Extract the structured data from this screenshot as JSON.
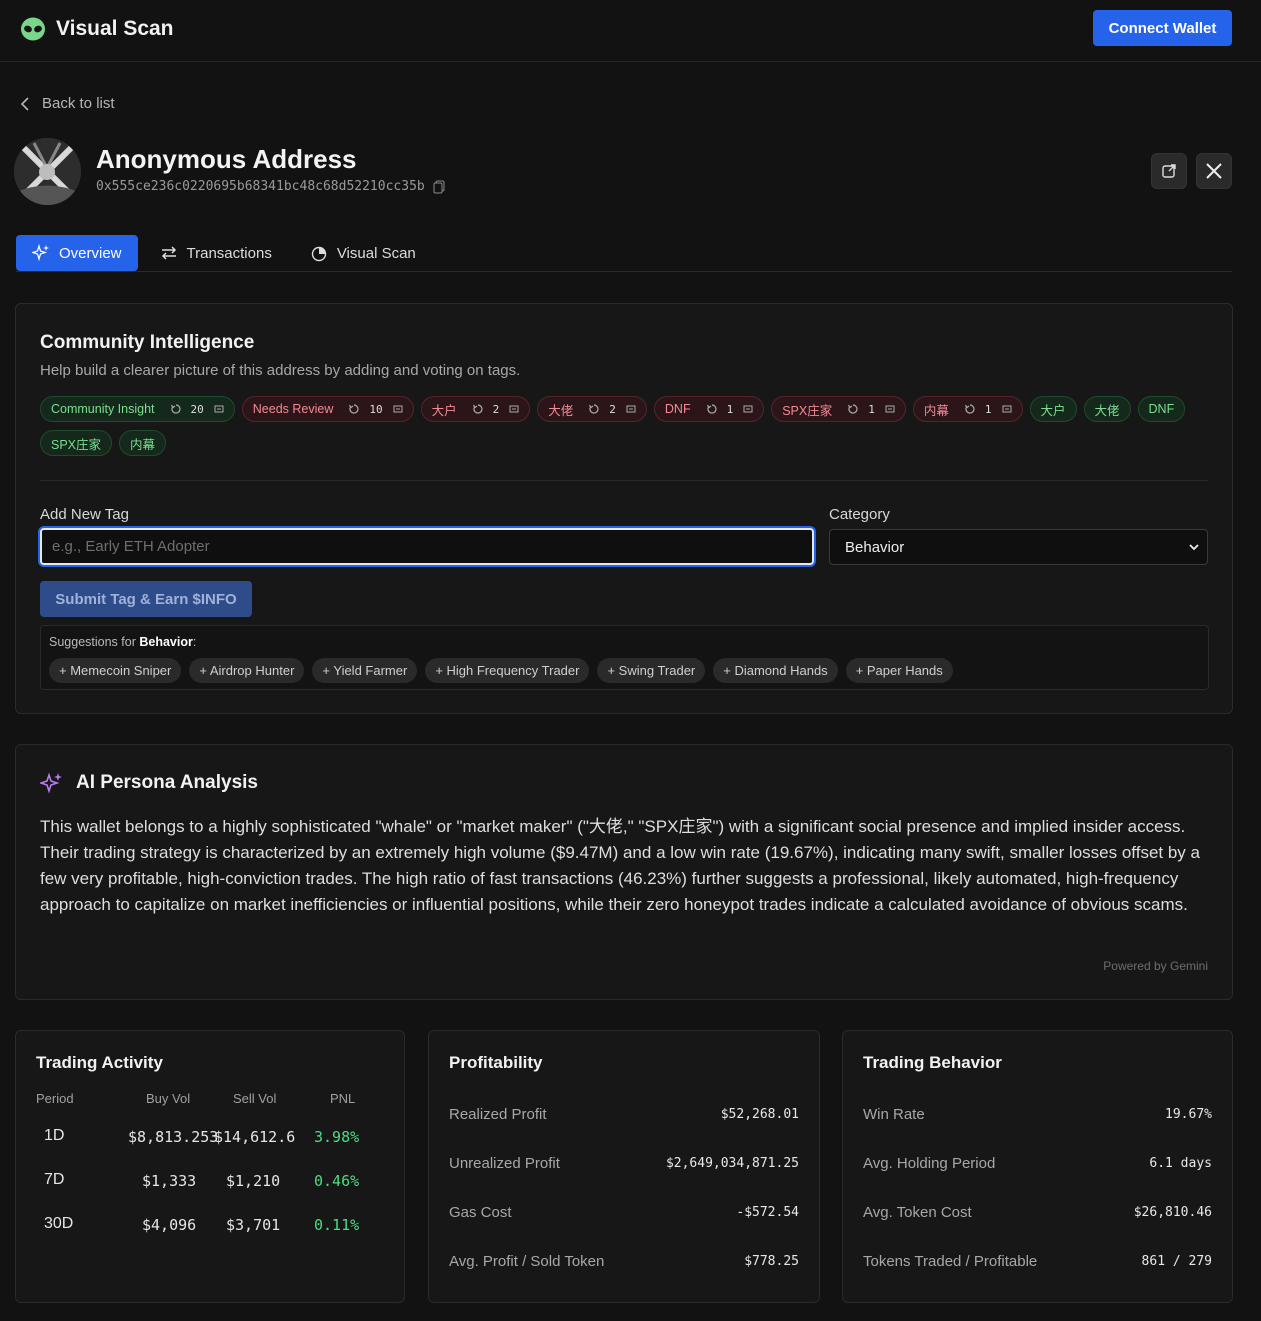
{
  "app": {
    "title": "Visual Scan",
    "connect_label": "Connect Wallet"
  },
  "nav": {
    "back_label": "Back to list"
  },
  "profile": {
    "name": "Anonymous Address",
    "address": "0x555ce236c0220695b68341bc48c68d52210cc35b"
  },
  "tabs": [
    {
      "label": "Overview",
      "icon": "sparkles-icon"
    },
    {
      "label": "Transactions",
      "icon": "arrows-swap-icon"
    },
    {
      "label": "Visual Scan",
      "icon": "scan-icon"
    }
  ],
  "community": {
    "title": "Community Intelligence",
    "subtitle": "Help build a clearer picture of this address by adding and voting on tags.",
    "voted_tags": [
      {
        "label": "Community Insight",
        "votes": "20",
        "color": "green"
      },
      {
        "label": "Needs Review",
        "votes": "10",
        "color": "red"
      },
      {
        "label": "大户",
        "votes": "2",
        "color": "red"
      },
      {
        "label": "大佬",
        "votes": "2",
        "color": "red"
      },
      {
        "label": "DNF",
        "votes": "1",
        "color": "red"
      },
      {
        "label": "SPX庄家",
        "votes": "1",
        "color": "red"
      },
      {
        "label": "内幕",
        "votes": "1",
        "color": "red"
      }
    ],
    "plain_tags": [
      "大户",
      "大佬",
      "DNF",
      "SPX庄家",
      "内幕"
    ],
    "add_label": "Add New Tag",
    "add_placeholder": "e.g., Early ETH Adopter",
    "category_label": "Category",
    "category_value": "Behavior",
    "submit_label": "Submit Tag & Earn $INFO",
    "suggestions_prefix": "Suggestions for ",
    "suggestions_category": "Behavior",
    "suggestions_suffix": ":",
    "suggestions": [
      "+ Memecoin Sniper",
      "+ Airdrop Hunter",
      "+ Yield Farmer",
      "+ High Frequency Trader",
      "+ Swing Trader",
      "+ Diamond Hands",
      "+ Paper Hands"
    ]
  },
  "persona": {
    "title": "AI Persona Analysis",
    "text": "This wallet belongs to a highly sophisticated \"whale\" or \"market maker\" (\"大佬,\" \"SPX庄家\") with a significant social presence and implied insider access. Their trading strategy is characterized by an extremely high volume ($9.47M) and a low win rate (19.67%), indicating many swift, smaller losses offset by a few very profitable, high-conviction trades. The high ratio of fast transactions (46.23%) further suggests a professional, likely automated, high-frequency approach to capitalize on market inefficiencies or influential positions, while their zero honeypot trades indicate a calculated avoidance of obvious scams.",
    "powered_by": "Powered by Gemini"
  },
  "trading_activity": {
    "title": "Trading Activity",
    "headers": [
      "Period",
      "Buy Vol",
      "Sell Vol",
      "PNL"
    ],
    "rows": [
      [
        "1D",
        "$8,813.253",
        "$14,612.6",
        "3.98%"
      ],
      [
        "7D",
        "$1,333",
        "$1,210",
        "0.46%"
      ],
      [
        "30D",
        "$4,096",
        "$3,701",
        "0.11%"
      ]
    ]
  },
  "profitability": {
    "title": "Profitability",
    "items": [
      {
        "label": "Realized Profit",
        "value": "$52,268.01",
        "positive": true
      },
      {
        "label": "Unrealized Profit",
        "value": "$2,649,034,871.25",
        "positive": true
      },
      {
        "label": "Gas Cost",
        "value": "-$572.54",
        "positive": false
      },
      {
        "label": "Avg. Profit / Sold Token",
        "value": "$778.25",
        "positive": true
      }
    ]
  },
  "trading_behavior": {
    "title": "Trading Behavior",
    "items": [
      {
        "label": "Win Rate",
        "value": "19.67%"
      },
      {
        "label": "Avg. Holding Period",
        "value": "6.1 days"
      },
      {
        "label": "Avg. Token Cost",
        "value": "$26,810.46"
      },
      {
        "label": "Tokens Traded / Profitable",
        "value": "861 / 279"
      }
    ]
  }
}
